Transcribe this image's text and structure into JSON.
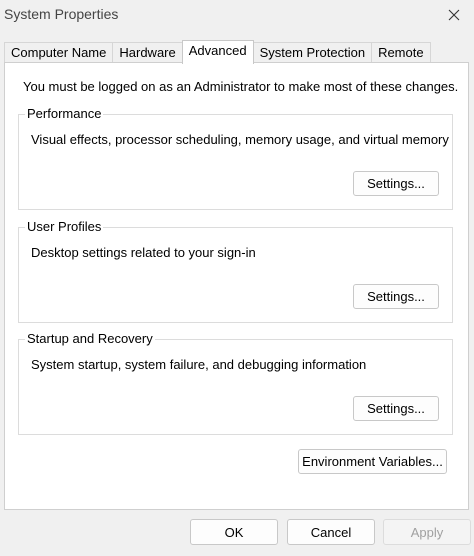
{
  "window": {
    "title": "System Properties"
  },
  "tabs": [
    {
      "label": "Computer Name",
      "active": false
    },
    {
      "label": "Hardware",
      "active": false
    },
    {
      "label": "Advanced",
      "active": true
    },
    {
      "label": "System Protection",
      "active": false
    },
    {
      "label": "Remote",
      "active": false
    }
  ],
  "advanced": {
    "admin_note": "You must be logged on as an Administrator to make most of these changes.",
    "groups": [
      {
        "label": "Performance",
        "description": "Visual effects, processor scheduling, memory usage, and virtual memory",
        "button": "Settings..."
      },
      {
        "label": "User Profiles",
        "description": "Desktop settings related to your sign-in",
        "button": "Settings..."
      },
      {
        "label": "Startup and Recovery",
        "description": "System startup, system failure, and debugging information",
        "button": "Settings..."
      }
    ],
    "env_button": "Environment Variables..."
  },
  "footer": {
    "ok": "OK",
    "cancel": "Cancel",
    "apply": "Apply"
  },
  "icons": {
    "close": "close-icon"
  },
  "colors": {
    "window_bg": "#f0f0f0",
    "panel_bg": "#ffffff",
    "disabled_text": "#a0a0a0"
  }
}
